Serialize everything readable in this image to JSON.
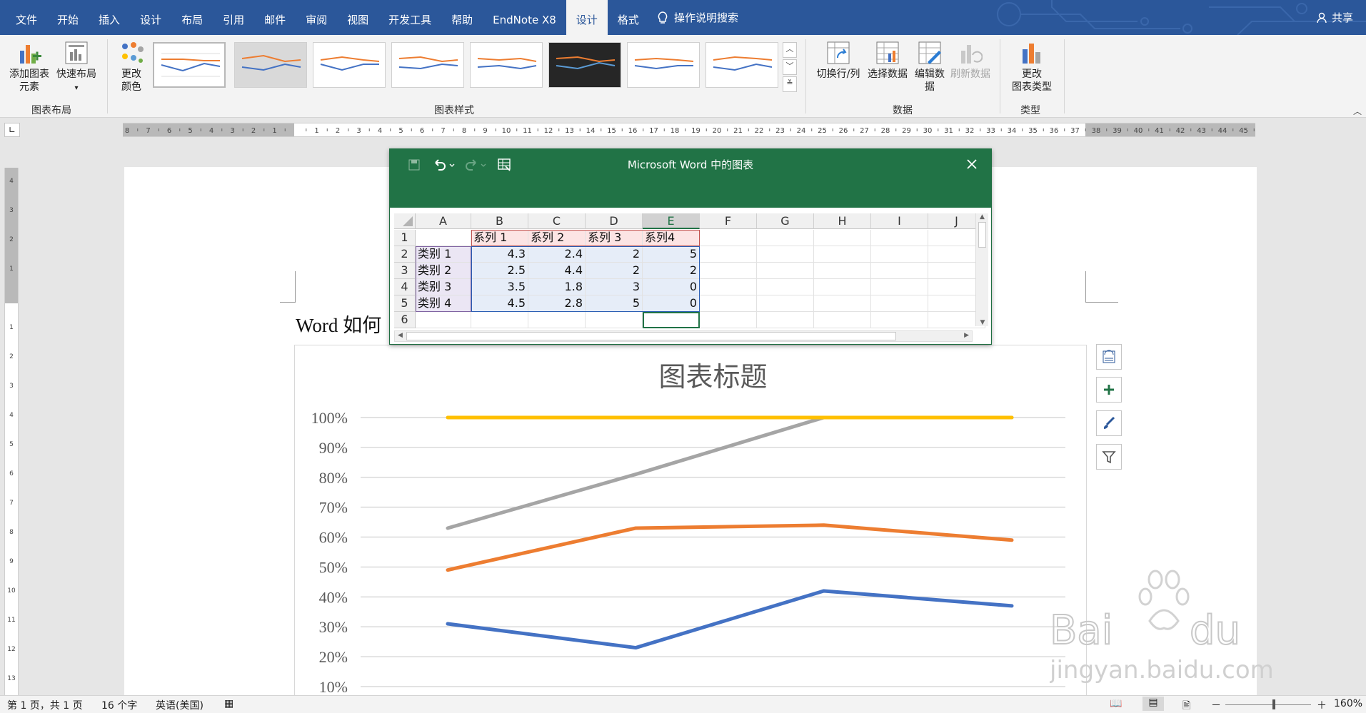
{
  "tabs": [
    "文件",
    "开始",
    "插入",
    "设计",
    "布局",
    "引用",
    "邮件",
    "审阅",
    "视图",
    "开发工具",
    "帮助",
    "EndNote X8",
    "设计",
    "格式"
  ],
  "active_tab_index": 12,
  "tell_me": "操作说明搜索",
  "share": "共享",
  "ribbon": {
    "add_chart_element": "添加图表\n元素",
    "quick_layout": "快速布局",
    "change_colors": "更改\n颜色",
    "switch_row_col": "切换行/列",
    "select_data": "选择数据",
    "edit_data": "编辑数\n据",
    "refresh_data": "刷新数据",
    "change_chart_type": "更改\n图表类型",
    "group_chart_layouts": "图表布局",
    "group_chart_styles": "图表样式",
    "group_data": "数据",
    "group_type": "类型"
  },
  "ruler_ticks": [
    "8",
    "7",
    "6",
    "5",
    "4",
    "3",
    "2",
    "1",
    "",
    "1",
    "2",
    "3",
    "4",
    "5",
    "6",
    "7",
    "8",
    "9",
    "10",
    "11",
    "12",
    "13",
    "14",
    "15",
    "16",
    "17",
    "18",
    "19",
    "20",
    "21",
    "22",
    "23",
    "24",
    "25",
    "26",
    "27",
    "28",
    "29",
    "30",
    "31",
    "32",
    "33",
    "34",
    "35",
    "36",
    "37",
    "38",
    "39",
    "40",
    "41",
    "42",
    "43",
    "44",
    "45"
  ],
  "doc_text": "Word 如何",
  "spreadsheet": {
    "title": "Microsoft Word 中的图表",
    "columns": [
      "A",
      "B",
      "C",
      "D",
      "E",
      "F",
      "G",
      "H",
      "I",
      "J"
    ],
    "rows": [
      "1",
      "2",
      "3",
      "4",
      "5",
      "6"
    ],
    "headers": [
      "",
      "系列 1",
      "系列 2",
      "系列 3",
      "系列4"
    ],
    "data": [
      [
        "类别 1",
        "4.3",
        "2.4",
        "2",
        "5"
      ],
      [
        "类别 2",
        "2.5",
        "4.4",
        "2",
        "2"
      ],
      [
        "类别 3",
        "3.5",
        "1.8",
        "3",
        "0"
      ],
      [
        "类别 4",
        "4.5",
        "2.8",
        "5",
        "0"
      ]
    ]
  },
  "chart_data": {
    "type": "line",
    "title": "图表标题",
    "categories": [
      "类别 1",
      "类别 2",
      "类别 3",
      "类别 4"
    ],
    "series": [
      {
        "values": [
          0.31,
          0.23,
          0.42,
          0.37
        ],
        "color": "#4472c4"
      },
      {
        "values": [
          0.49,
          0.63,
          0.64,
          0.59
        ],
        "color": "#ed7d31"
      },
      {
        "values": [
          0.63,
          0.81,
          1.0,
          1.0
        ],
        "color": "#a5a5a5"
      },
      {
        "values": [
          1.0,
          1.0,
          1.0,
          1.0
        ],
        "color": "#ffc000"
      }
    ],
    "y_ticks": [
      "100%",
      "90%",
      "80%",
      "70%",
      "60%",
      "50%",
      "40%",
      "30%",
      "20%",
      "10%"
    ],
    "ylim": [
      0.1,
      1.0
    ],
    "grid": true
  },
  "status": {
    "page": "第 1 页，共 1 页",
    "words": "16 个字",
    "language": "英语(美国)",
    "zoom": "160%"
  },
  "colors": {
    "word_blue": "#2b579a",
    "excel_green": "#217346"
  }
}
